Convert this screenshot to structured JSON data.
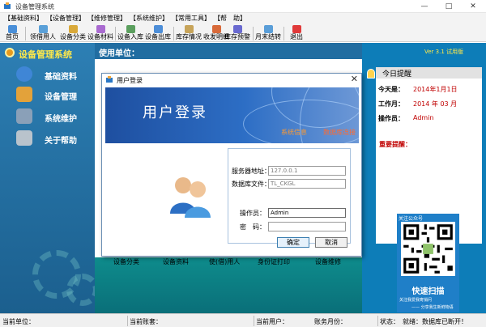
{
  "window": {
    "title": "设备管理系统",
    "controls": [
      "—",
      "□",
      "✕"
    ]
  },
  "menubar": {
    "items": [
      "【基础资料】",
      "【设备管理】",
      "【维修管理】",
      "【系统维护】",
      "【常用工具】",
      "【帮　助】"
    ]
  },
  "toolbar": {
    "items": [
      "首页",
      "领借用人",
      "设备分类",
      "设备材料",
      "设备入库",
      "设备出库",
      "库存情况",
      "收发明细",
      "库存预警",
      "月末结转",
      "退出"
    ]
  },
  "sidebar": {
    "title": "设备管理系统",
    "items": [
      "基础资料",
      "设备管理",
      "系统维护",
      "关于帮助"
    ]
  },
  "main": {
    "header": "使用单位：",
    "functions": [
      "设备分类",
      "设备资料",
      "使(借)用人",
      "身份证打印",
      "设备维修"
    ]
  },
  "reminder": {
    "version": "Ver 3.1 试用版",
    "title": "今日提醒",
    "today_label": "今天是：",
    "today_value": "2014年1月1日",
    "month_label": "工作月：",
    "month_value": "2014 年 03 月",
    "operator_label": "操作员：",
    "operator_value": "Admin",
    "warning": "重要提醒："
  },
  "qr_card": {
    "top": "关注公众号",
    "scan": "快速扫描",
    "line1": "关注我爱我寄捎问",
    "line2": "—— 分享我生新鲜物语"
  },
  "statusbar": {
    "unit": "当前单位：",
    "account": "当前账套：",
    "user": "当前用户：",
    "month": "账务月份：",
    "status": "状态：",
    "status_value": "就绪：数据库已断开！"
  },
  "login_dialog": {
    "title": "用户登录",
    "banner_title": "用户登录",
    "banner_link1": "系统信息",
    "banner_link2": "数据库连接",
    "server_label": "服务器地址：",
    "server_value": "127.0.0.1",
    "db_label": "数据库文件：",
    "db_value": "TL_CKGL",
    "operator_label": "操作员：",
    "operator_value": "Admin",
    "password_label": "密　码：",
    "password_value": "",
    "ok": "确定",
    "cancel": "取消"
  },
  "colors": {
    "sidebar": "#1b5f8e",
    "accent_yellow": "#ffe94a",
    "banner": "#1e4fa0",
    "teal": "#0e8c8c",
    "red": "#c00000"
  }
}
